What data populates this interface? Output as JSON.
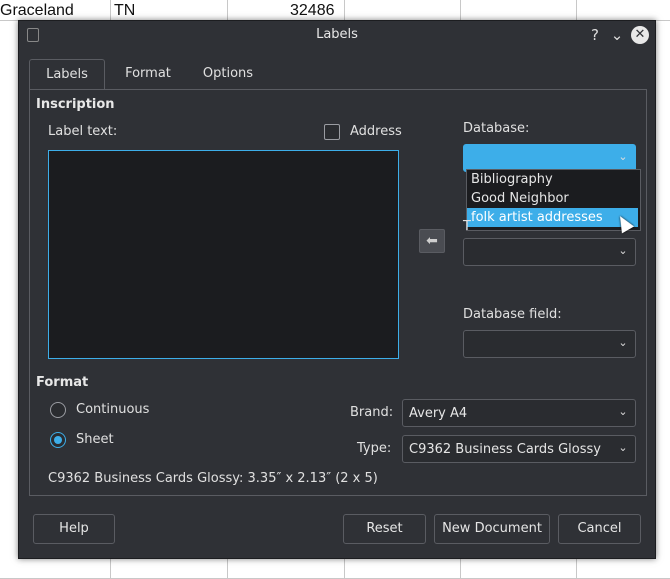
{
  "spreadsheet": {
    "cells": [
      "Graceland",
      "TN",
      "32486"
    ]
  },
  "dialog": {
    "title": "Labels",
    "help_icon": "question-icon",
    "collapse_icon": "chevron-down-icon",
    "close_icon": "close-icon"
  },
  "tabs": [
    {
      "label": "Labels",
      "active": true
    },
    {
      "label": "Format",
      "active": false
    },
    {
      "label": "Options",
      "active": false
    }
  ],
  "inscription": {
    "heading": "Inscription",
    "label_text_label": "Label text:",
    "label_text_value": "",
    "address_label": "Address",
    "address_checked": false
  },
  "database": {
    "label": "Database:",
    "value": "",
    "options": [
      "Bibliography",
      "Good Neighbor",
      "folk artist addresses"
    ],
    "highlighted": "folk artist addresses",
    "table_label": "T",
    "table_value": "",
    "field_label": "Database field:",
    "field_value": ""
  },
  "format": {
    "heading": "Format",
    "continuous_label": "Continuous",
    "sheet_label": "Sheet",
    "selected": "Sheet",
    "brand_label": "Brand:",
    "brand_value": "Avery A4",
    "type_label": "Type:",
    "type_value": "C9362 Business Cards Glossy",
    "summary": "C9362 Business Cards Glossy: 3.35″ x 2.13″ (2 x 5)"
  },
  "buttons": {
    "help": "Help",
    "reset": "Reset",
    "new_document": "New Document",
    "cancel": "Cancel"
  },
  "colors": {
    "accent": "#3daee9",
    "dialog_bg": "#2f3136"
  }
}
